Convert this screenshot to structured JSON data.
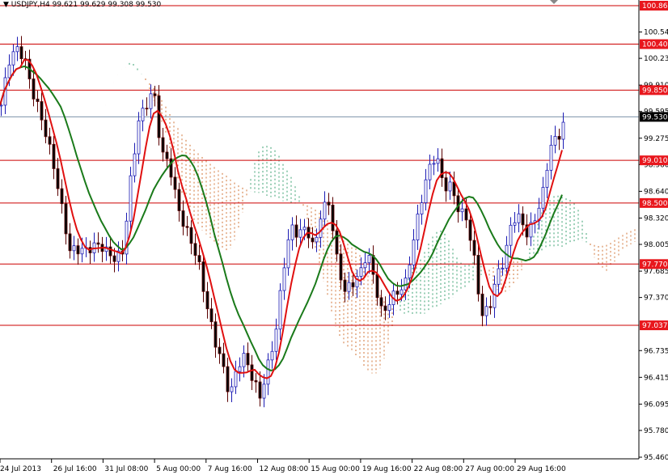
{
  "chart_data": {
    "type": "candlestick",
    "title": "USDJPY,H4",
    "ohlc_header": [
      "99.621",
      "99.629",
      "99.308",
      "99.530"
    ],
    "symbol": "USDJPY",
    "timeframe": "H4",
    "ylim": [
      95.46,
      100.86
    ],
    "y_ticks": [
      "100.545",
      "100.230",
      "99.910",
      "99.595",
      "99.275",
      "98.960",
      "98.640",
      "98.320",
      "98.005",
      "97.685",
      "97.370",
      "96.735",
      "96.415",
      "96.095",
      "95.780",
      "95.460"
    ],
    "x_ticks": [
      "24 Jul 2013",
      "26 Jul 16:00",
      "31 Jul 08:00",
      "5 Aug 00:00",
      "7 Aug 16:00",
      "12 Aug 08:00",
      "15 Aug 00:00",
      "19 Aug 16:00",
      "22 Aug 08:00",
      "27 Aug 00:00",
      "29 Aug 16:00"
    ],
    "levels": [
      "100.860",
      "100.400",
      "99.850",
      "99.010",
      "98.500",
      "97.770",
      "97.037"
    ],
    "current_price": "99.530",
    "closes": [
      99.67,
      100.2,
      100.35,
      100.25,
      99.86,
      99.6,
      99.28,
      98.9,
      98.41,
      97.93,
      97.95,
      97.93,
      97.98,
      98.0,
      97.9,
      97.83,
      97.93,
      98.8,
      99.48,
      99.67,
      99.86,
      99.09,
      98.99,
      98.51,
      98.22,
      98.03,
      97.73,
      97.25,
      96.86,
      96.57,
      96.18,
      96.57,
      96.67,
      96.38,
      96.18,
      96.57,
      96.96,
      97.73,
      98.22,
      98.12,
      98.22,
      97.93,
      98.41,
      98.51,
      97.83,
      97.44,
      97.54,
      97.64,
      97.93,
      97.54,
      97.15,
      97.35,
      97.44,
      97.54,
      98.03,
      98.51,
      98.89,
      99.09,
      98.7,
      98.7,
      98.41,
      98.32,
      97.83,
      97.15,
      97.25,
      97.64,
      97.83,
      98.32,
      98.32,
      98.12,
      98.32,
      98.61,
      99.19,
      99.28,
      99.53
    ],
    "colors": {
      "level_line": "#cc0000",
      "level_label_bg": "#e8171d",
      "current_line": "#7d93a8",
      "bull_candle": "#1c1cb4",
      "bear_candle": "#5a0000",
      "tenkan": "#e01010",
      "kijun": "#1a7a1a",
      "cloud_bear": "#d2763a",
      "cloud_bull": "#3aa070"
    }
  }
}
